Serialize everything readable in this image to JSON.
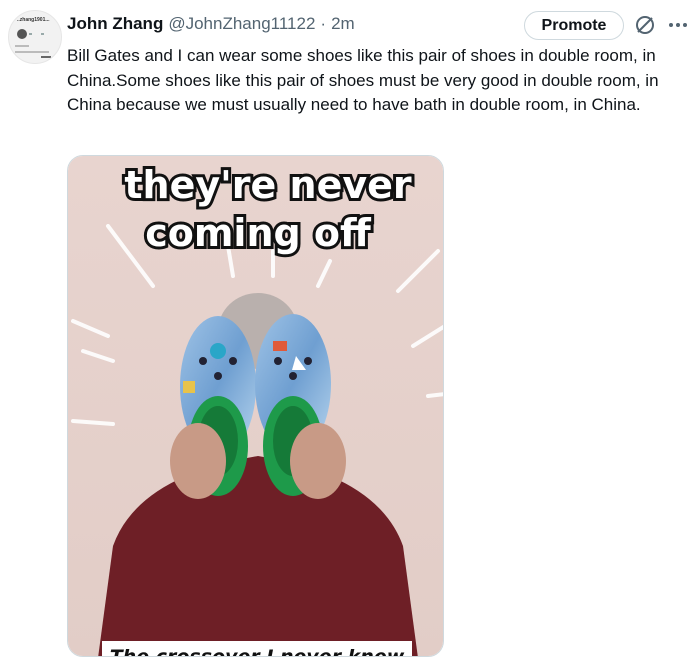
{
  "tweet": {
    "author_name": "John Zhang",
    "author_handle": "@JohnZhang11122",
    "separator": "·",
    "time_ago": "2m",
    "text": "Bill Gates and I can wear some shoes like this pair of shoes in double room, in China.Some shoes like this pair of shoes must be very good in double room, in China because we must usually need to have bath in double room, in China."
  },
  "actions": {
    "promote_label": "Promote",
    "analytics_icon": "analytics-icon",
    "more_icon": "more-icon"
  },
  "media": {
    "caption_top_line1": "they're never",
    "caption_top_line2": "coming off",
    "caption_bottom": "The crossover I never knew"
  },
  "avatar": {
    "title": "..zhang1901...",
    "name": "John Zhang"
  },
  "colors": {
    "primary_text": "#0f1419",
    "secondary_text": "#536471",
    "border": "#cfd9de"
  }
}
